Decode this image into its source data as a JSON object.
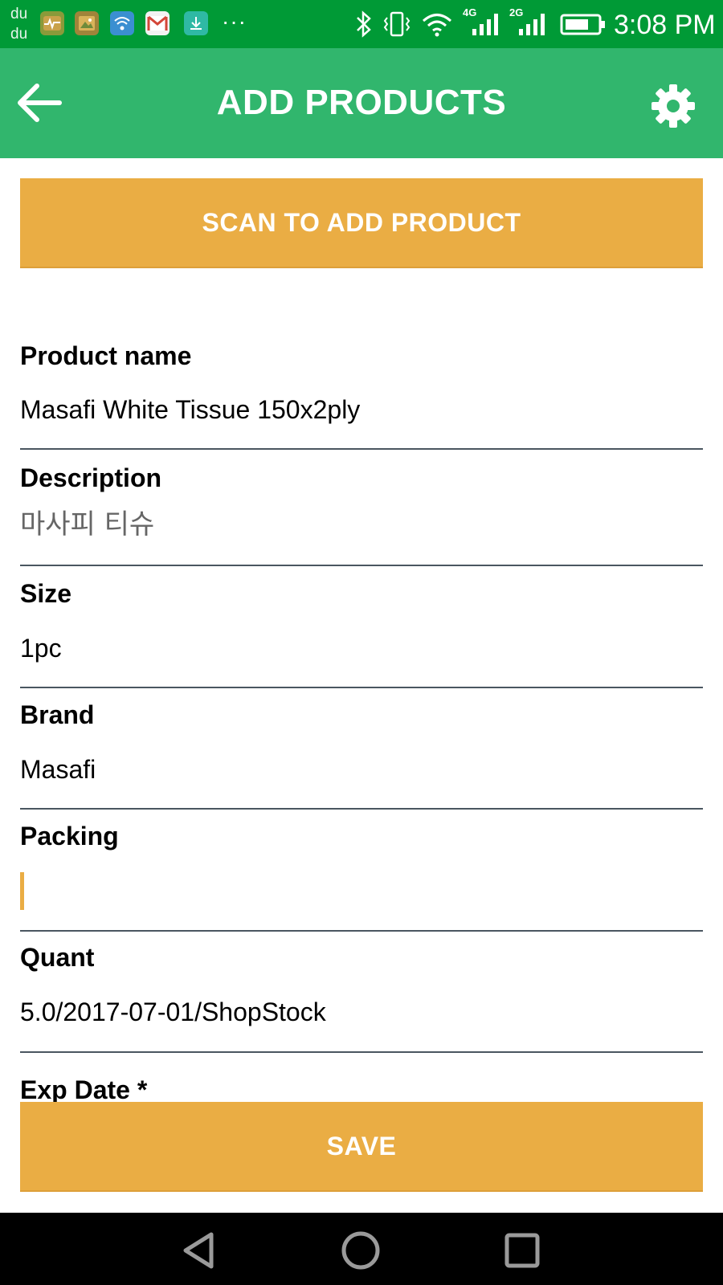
{
  "status_bar": {
    "carrier_top": "du",
    "carrier_bottom": "du",
    "overflow": "···",
    "time": "3:08 PM",
    "network_4g": "4G",
    "network_2g": "2G",
    "icons": [
      "health-app-icon",
      "gallery-app-icon",
      "wifi-app-icon",
      "gmail-icon",
      "download-icon",
      "bluetooth-icon",
      "vibrate-icon",
      "wifi-signal-icon",
      "signal-4g-icon",
      "signal-2g-icon",
      "battery-icon"
    ]
  },
  "app_bar": {
    "title": "ADD PRODUCTS",
    "back_icon": "arrow-left-icon",
    "settings_icon": "gear-icon"
  },
  "scan_button": {
    "label": "SCAN TO ADD PRODUCT"
  },
  "form": {
    "product_name": {
      "label": "Product name",
      "value": "Masafi White Tissue 150x2ply"
    },
    "description": {
      "label": "Description",
      "value": "마사피 티슈"
    },
    "size": {
      "label": "Size",
      "value": "1pc"
    },
    "brand": {
      "label": "Brand",
      "value": "Masafi"
    },
    "packing": {
      "label": "Packing",
      "value": ""
    },
    "quant": {
      "label": "Quant",
      "value": "5.0/2017-07-01/ShopStock"
    },
    "exp_date": {
      "label": "Exp Date *"
    }
  },
  "save_button": {
    "label": "SAVE"
  },
  "colors": {
    "status_bar": "#009a36",
    "app_bar": "#31b66d",
    "accent": "#eaad44",
    "divider": "#4a5660"
  }
}
